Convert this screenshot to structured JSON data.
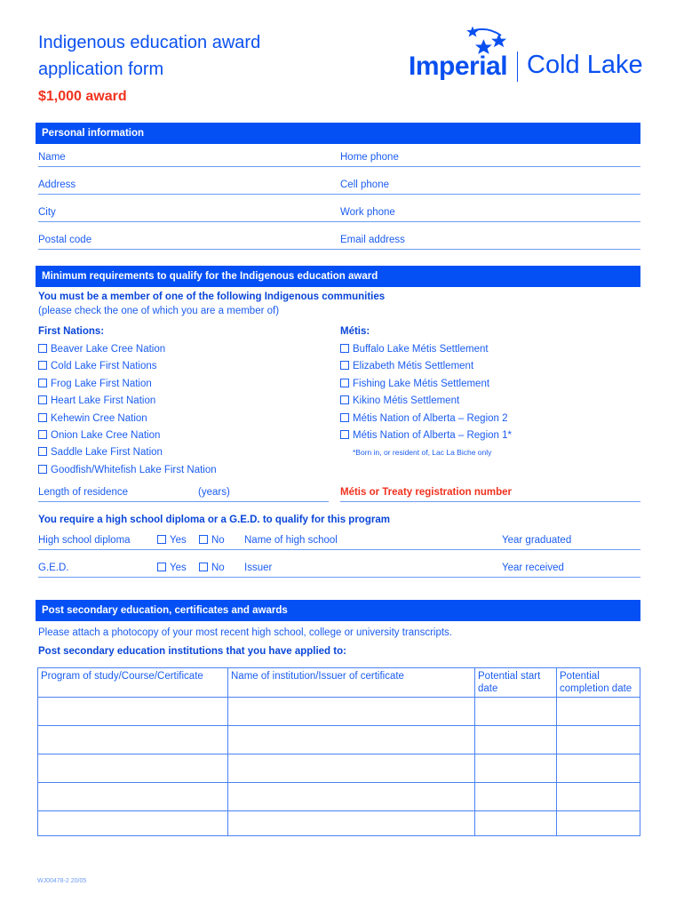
{
  "header": {
    "title": "Indigenous education award application form",
    "award": "$1,000 award",
    "logo": {
      "brand": "Imperial",
      "place": "Cold Lake",
      "icon": "stars-icon"
    }
  },
  "colors": {
    "primary_blue": "#0550f5",
    "accent_red": "#f0321e",
    "line_blue": "#6a9cf5"
  },
  "personal": {
    "heading": "Personal information",
    "left_fields": [
      "Name",
      "Address",
      "City",
      "Postal code"
    ],
    "right_fields": [
      "Home phone",
      "Cell phone",
      "Work phone",
      "Email address"
    ]
  },
  "requirements": {
    "heading": "Minimum requirements to qualify for the Indigenous education award",
    "membership_title": "You must be a member of one of the following Indigenous communities",
    "membership_note": "(please check the one of which you are a member of)",
    "first_nations": {
      "label": "First Nations:",
      "options": [
        "Beaver Lake Cree Nation",
        "Cold Lake First Nations",
        "Frog Lake First Nation",
        "Heart Lake First Nation",
        "Kehewin Cree Nation",
        "Onion Lake Cree Nation",
        "Saddle Lake First Nation",
        "Goodfish/Whitefish Lake First Nation"
      ]
    },
    "metis": {
      "label": "Métis:",
      "options": [
        "Buffalo Lake Métis Settlement",
        "Elizabeth Métis Settlement",
        "Fishing Lake Métis Settlement",
        "Kikino Métis Settlement",
        "Métis Nation of Alberta – Region 2",
        "Métis Nation of Alberta – Region 1*"
      ],
      "footnote": "*Born in, or resident of, Lac La Biche only"
    },
    "residence_label": "Length of residence",
    "residence_unit": "(years)",
    "registration_label": "Métis or Treaty registration number",
    "diploma_title": "You require a high school diploma or a G.E.D. to qualify for this program",
    "diploma": {
      "label": "High school diploma",
      "yes": "Yes",
      "no": "No",
      "name_label": "Name of high school",
      "year_label": "Year graduated"
    },
    "ged": {
      "label": "G.E.D.",
      "yes": "Yes",
      "no": "No",
      "name_label": "Issuer",
      "year_label": "Year received"
    }
  },
  "post_secondary": {
    "heading": "Post secondary education, certificates and awards",
    "attach_note": "Please attach a photocopy of your most recent high school, college or university transcripts.",
    "applied_title": "Post secondary education institutions that you have applied to:",
    "columns": [
      "Program of study/Course/Certificate",
      "Name of institution/Issuer of certificate",
      "Potential start date",
      "Potential completion date"
    ],
    "rows": [
      [
        "",
        "",
        "",
        ""
      ],
      [
        "",
        "",
        "",
        ""
      ],
      [
        "",
        "",
        "",
        ""
      ],
      [
        "",
        "",
        "",
        ""
      ],
      [
        "",
        "",
        "",
        ""
      ]
    ]
  },
  "footer": {
    "code": "WJ00478-2 20/05"
  }
}
